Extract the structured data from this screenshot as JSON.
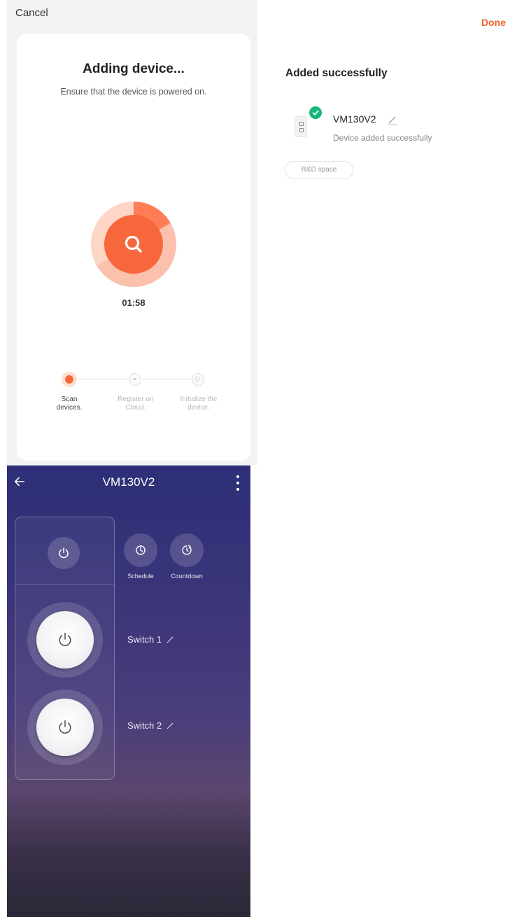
{
  "adding": {
    "cancel_label": "Cancel",
    "title": "Adding device...",
    "subtitle": "Ensure that the device is powered on.",
    "timer": "01:58",
    "steps": [
      {
        "label_line1": "Scan",
        "label_line2": "devices.",
        "state": "active"
      },
      {
        "label_line1": "Register on",
        "label_line2": "Cloud.",
        "state": "pending"
      },
      {
        "label_line1": "Initialize the",
        "label_line2": "device.",
        "state": "pending"
      }
    ],
    "accent_color": "#f6683c"
  },
  "added": {
    "done_label": "Done",
    "title": "Added successfully",
    "device_name": "VM130V2",
    "device_status": "Device added successfully",
    "room_chip": "R&D space",
    "success_color": "#16b879"
  },
  "control": {
    "title": "VM130V2",
    "schedule_label": "Schedule",
    "countdown_label": "Countdown",
    "switch1_label": "Switch 1",
    "switch2_label": "Switch 2"
  }
}
